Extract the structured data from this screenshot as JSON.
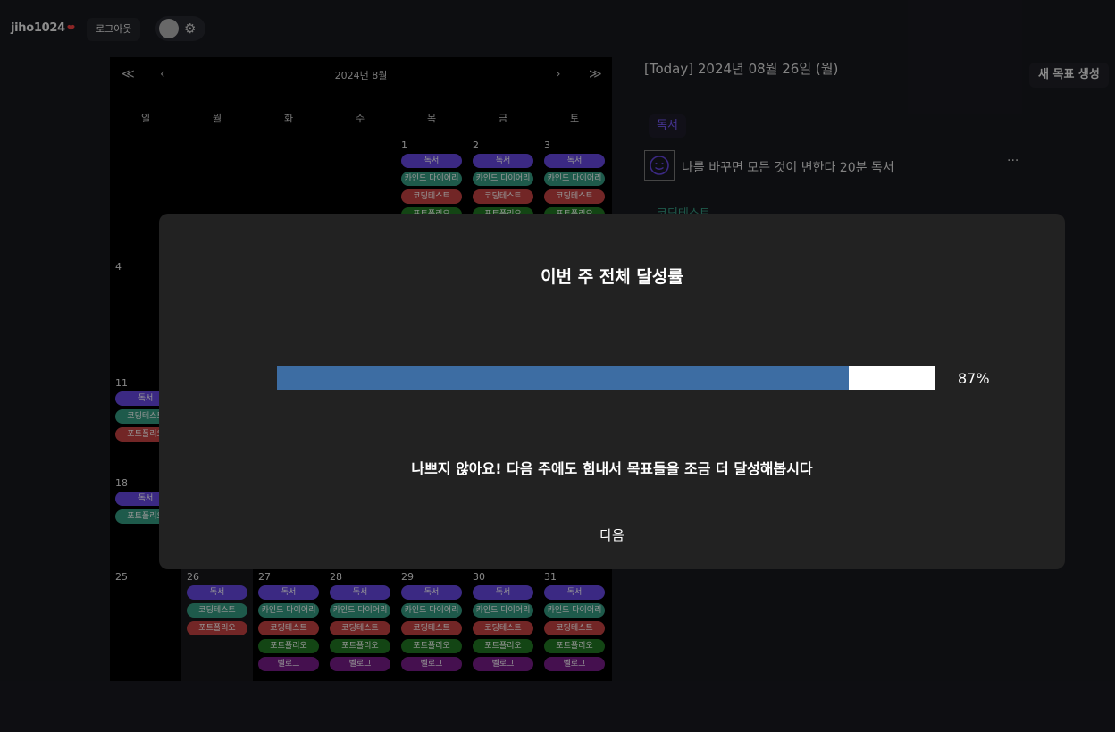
{
  "header": {
    "username": "jiho1024",
    "logout_label": "로그아웃"
  },
  "calendar": {
    "title": "2024년 8월",
    "nav": {
      "prev_year": "≪",
      "prev_month": "‹",
      "next_month": "›",
      "next_year": "≫"
    },
    "weekdays": [
      "일",
      "월",
      "화",
      "수",
      "목",
      "금",
      "토"
    ],
    "weeks": [
      [
        {
          "day": "",
          "chips": []
        },
        {
          "day": "",
          "chips": []
        },
        {
          "day": "",
          "chips": []
        },
        {
          "day": "",
          "chips": []
        },
        {
          "day": "1",
          "chips": [
            [
              "독서",
              "read"
            ],
            [
              "카인드 다이어리",
              "kind"
            ],
            [
              "코딩테스트",
              "code"
            ],
            [
              "포트폴리오",
              "port"
            ]
          ]
        },
        {
          "day": "2",
          "chips": [
            [
              "독서",
              "read"
            ],
            [
              "카인드 다이어리",
              "kind"
            ],
            [
              "코딩테스트",
              "code"
            ],
            [
              "포트폴리오",
              "port"
            ]
          ]
        },
        {
          "day": "3",
          "chips": [
            [
              "독서",
              "read"
            ],
            [
              "카인드 다이어리",
              "kind"
            ],
            [
              "코딩테스트",
              "code"
            ],
            [
              "포트폴리오",
              "port"
            ]
          ]
        }
      ],
      [
        {
          "day": "4",
          "chips": []
        },
        {
          "day": "",
          "chips": []
        },
        {
          "day": "",
          "chips": []
        },
        {
          "day": "",
          "chips": []
        },
        {
          "day": "",
          "chips": []
        },
        {
          "day": "",
          "chips": []
        },
        {
          "day": "",
          "chips": []
        }
      ],
      [
        {
          "day": "11",
          "chips": [
            [
              "독서",
              "read"
            ],
            [
              "코딩테스트",
              "kind"
            ],
            [
              "포트폴리오",
              "code"
            ]
          ]
        },
        {
          "day": "",
          "chips": []
        },
        {
          "day": "",
          "chips": []
        },
        {
          "day": "",
          "chips": []
        },
        {
          "day": "",
          "chips": []
        },
        {
          "day": "",
          "chips": []
        },
        {
          "day": "",
          "chips": []
        }
      ],
      [
        {
          "day": "18",
          "chips": [
            [
              "독서",
              "read"
            ],
            [
              "포트폴리오",
              "kind"
            ]
          ]
        },
        {
          "day": "",
          "chips": []
        },
        {
          "day": "",
          "chips": []
        },
        {
          "day": "",
          "chips": []
        },
        {
          "day": "",
          "chips": []
        },
        {
          "day": "",
          "chips": []
        },
        {
          "day": "",
          "chips": []
        }
      ],
      [
        {
          "day": "25",
          "chips": []
        },
        {
          "day": "26",
          "chips": [
            [
              "독서",
              "read"
            ],
            [
              "코딩테스트",
              "kind"
            ],
            [
              "포트폴리오",
              "code"
            ]
          ]
        },
        {
          "day": "27",
          "chips": [
            [
              "독서",
              "read"
            ],
            [
              "카인드 다이어리",
              "kind"
            ],
            [
              "코딩테스트",
              "code"
            ],
            [
              "포트폴리오",
              "port"
            ],
            [
              "벨로그",
              "blog"
            ]
          ]
        },
        {
          "day": "28",
          "chips": [
            [
              "독서",
              "read"
            ],
            [
              "카인드 다이어리",
              "kind"
            ],
            [
              "코딩테스트",
              "code"
            ],
            [
              "포트폴리오",
              "port"
            ],
            [
              "벨로그",
              "blog"
            ]
          ]
        },
        {
          "day": "29",
          "chips": [
            [
              "독서",
              "read"
            ],
            [
              "카인드 다이어리",
              "kind"
            ],
            [
              "코딩테스트",
              "code"
            ],
            [
              "포트폴리오",
              "port"
            ],
            [
              "벨로그",
              "blog"
            ]
          ]
        },
        {
          "day": "30",
          "chips": [
            [
              "독서",
              "read"
            ],
            [
              "카인드 다이어리",
              "kind"
            ],
            [
              "코딩테스트",
              "code"
            ],
            [
              "포트폴리오",
              "port"
            ],
            [
              "벨로그",
              "blog"
            ]
          ]
        },
        {
          "day": "31",
          "chips": [
            [
              "독서",
              "read"
            ],
            [
              "카인드 다이어리",
              "kind"
            ],
            [
              "코딩테스트",
              "code"
            ],
            [
              "포트폴리오",
              "port"
            ],
            [
              "벨로그",
              "blog"
            ]
          ]
        }
      ]
    ]
  },
  "panel": {
    "today_label": "[Today] 2024년 08월 26일 (월)",
    "new_goal_label": "새 목표 생성",
    "category_1": "독서",
    "goal_text": "나를 바꾸면 모든 것이 변한다 20분 독서",
    "more_label": "···",
    "category_2": "코딩테스트"
  },
  "modal": {
    "title": "이번 주 전체 달성률",
    "progress_percent": 87,
    "progress_label": "87%",
    "message": "나쁘지 않아요! 다음 주에도 힘내서 목표들을 조금 더 달성해봅시다",
    "next_label": "다음"
  },
  "colors": {
    "progress_fill": "#3d6da3",
    "chip_read": "#5b3fc9",
    "chip_kind": "#2f8a73",
    "chip_code": "#b03b3b",
    "chip_port": "#1e6b20",
    "chip_blog": "#6a1a7a"
  }
}
